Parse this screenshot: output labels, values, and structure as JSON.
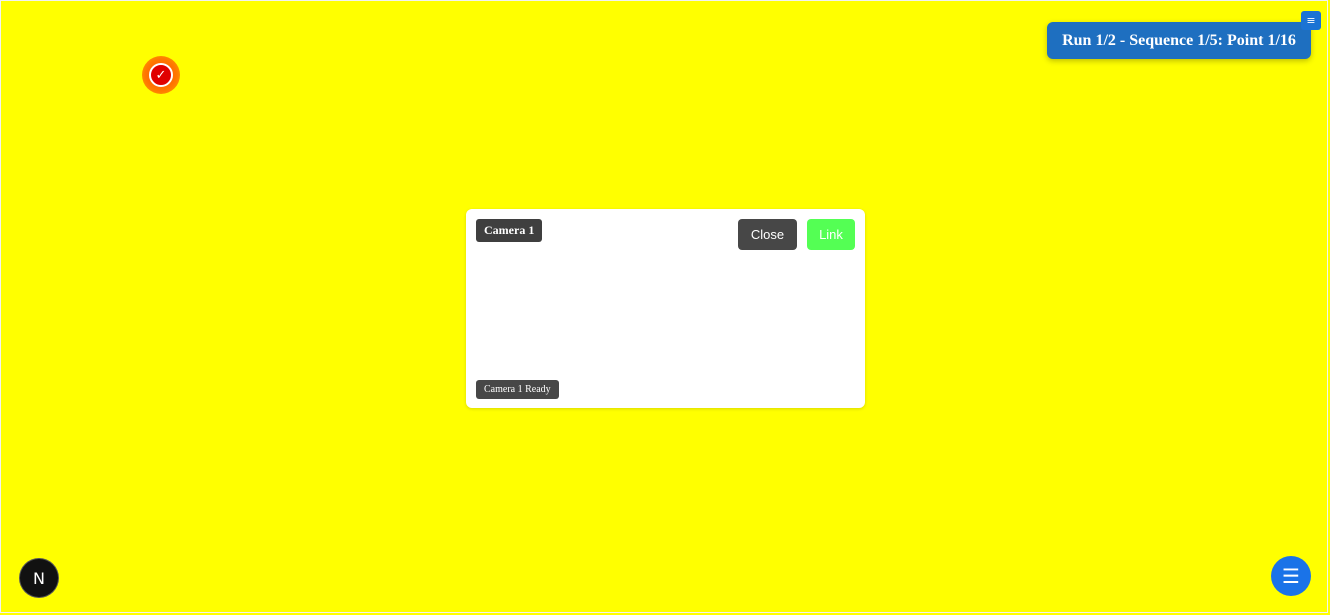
{
  "target": {
    "icon": "checkmark-icon",
    "glyph": "✓"
  },
  "progress": {
    "text": "Run 1/2 - Sequence 1/5: Point 1/16"
  },
  "mini_menu": {
    "icon": "hamburger-icon",
    "glyph": "≡"
  },
  "camera": {
    "title": "Camera 1",
    "close_label": "Close",
    "link_label": "Link",
    "status": "Camera 1 Ready"
  },
  "logo": {
    "icon": "n-logo-icon",
    "glyph": "N"
  },
  "menu_fab": {
    "icon": "menu-icon",
    "glyph": "☰"
  },
  "colors": {
    "background": "#ffff00",
    "banner": "#1e6fc0",
    "link_button": "#54ff54",
    "close_button": "#474747",
    "fab": "#1a73e8"
  }
}
